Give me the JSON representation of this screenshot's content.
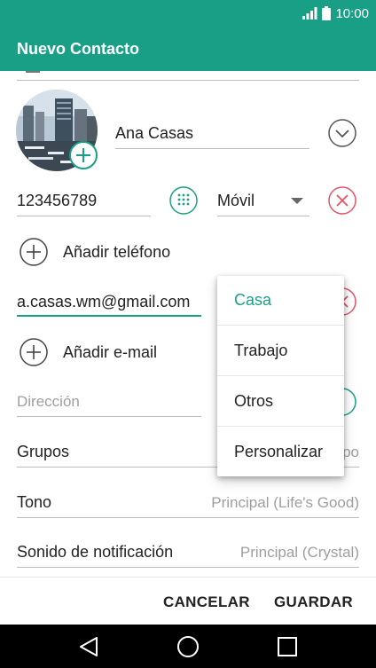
{
  "status_bar": {
    "time": "10:00"
  },
  "app_bar": {
    "title": "Nuevo Contacto"
  },
  "contact": {
    "name": "Ana Casas",
    "phone": "123456789",
    "phone_type": "Móvil",
    "add_phone_label": "Añadir teléfono",
    "email": "a.casas.wm@gmail.com",
    "add_email_label": "Añadir e-mail",
    "address_placeholder": "Dirección",
    "groups_label": "Grupos",
    "groups_value_partial": "po",
    "ringtone_label": "Tono",
    "ringtone_value": "Principal (Life's Good)",
    "notification_label": "Sonido de notificación",
    "notification_value": "Principal (Crystal)"
  },
  "email_type_menu": {
    "options": [
      "Casa",
      "Trabajo",
      "Otros",
      "Personalizar"
    ],
    "selected": "Casa"
  },
  "actions": {
    "cancel": "CANCELAR",
    "save": "GUARDAR"
  },
  "colors": {
    "accent": "#199f86",
    "delete": "#e05568",
    "text": "#222222",
    "hint": "#9e9e9e"
  }
}
